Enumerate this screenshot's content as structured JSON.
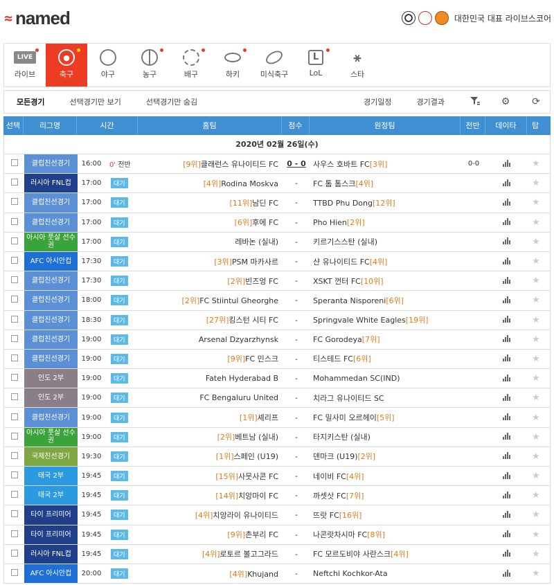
{
  "brand": {
    "logo_text": "named",
    "tagline": "대한민국 대표 라이브스코어"
  },
  "nav": [
    {
      "label": "라이브",
      "icon": "live-icon",
      "badge": "LIVE",
      "dot": true,
      "active": false
    },
    {
      "label": "축구",
      "icon": "soccer-ball-icon",
      "dot": true,
      "active": true
    },
    {
      "label": "야구",
      "icon": "baseball-icon",
      "dot": false,
      "active": false
    },
    {
      "label": "농구",
      "icon": "basketball-icon",
      "dot": true,
      "active": false
    },
    {
      "label": "배구",
      "icon": "volleyball-icon",
      "dot": true,
      "active": false
    },
    {
      "label": "하키",
      "icon": "hockey-puck-icon",
      "dot": true,
      "active": false
    },
    {
      "label": "미식축구",
      "icon": "football-icon",
      "dot": false,
      "active": false
    },
    {
      "label": "LoL",
      "icon": "lol-icon",
      "dot": true,
      "active": false
    },
    {
      "label": "스타",
      "icon": "starcraft-icon",
      "dot": false,
      "active": false
    }
  ],
  "filters": {
    "all": "모든경기",
    "selected_only": "선택경기만 보기",
    "hide_selected": "선택경기만 숨김",
    "schedule": "경기일정",
    "results": "경기결과"
  },
  "table_headers": {
    "select": "선택",
    "league": "리그명",
    "time": "시간",
    "home": "홈팀",
    "score": "점수",
    "away": "원정팀",
    "half": "전반",
    "data": "데이타",
    "top": "탑"
  },
  "date_label": "2020년 02월 26일(수)",
  "colors": {
    "accent": "#ed3c24",
    "header_blue": "#3f8fd2",
    "rank": "#e07b1a"
  },
  "matches": [
    {
      "league": "클럽친선경기",
      "league_color": "#5b8fd6",
      "time": "16:00",
      "status_min": "0'",
      "status_text": "전반",
      "home_rank": "[9위]",
      "home": "클래런스 유나이티드 FC",
      "score": "0 - 0",
      "away": "사우스 호바트 FC",
      "away_rank": "[3위]",
      "half": "0-0"
    },
    {
      "league": "러시아 FNL컵",
      "league_color": "#1f3f8a",
      "time": "17:00",
      "badge": "대기",
      "home_rank": "[4위]",
      "home": "Rodina Moskva",
      "score": "-",
      "away": "FC 톰 톰스크",
      "away_rank": "[4위]",
      "half": ""
    },
    {
      "league": "클럽친선경기",
      "league_color": "#5b8fd6",
      "time": "17:00",
      "badge": "대기",
      "home_rank": "[11위]",
      "home": "남딘 FC",
      "score": "-",
      "away": "TTBD Phu Dong",
      "away_rank": "[12위]",
      "half": ""
    },
    {
      "league": "클럽친선경기",
      "league_color": "#5b8fd6",
      "time": "17:00",
      "badge": "대기",
      "home_rank": "[6위]",
      "home": "후에 FC",
      "score": "-",
      "away": "Pho Hien",
      "away_rank": "[2위]",
      "half": ""
    },
    {
      "league": "아시아 풋살 선수권",
      "league_color": "#3aa33a",
      "time": "17:00",
      "badge": "대기",
      "home_rank": "",
      "home": "레바논 (실내)",
      "score": "-",
      "away": "키르기스스탄 (실내)",
      "away_rank": "",
      "half": ""
    },
    {
      "league": "AFC 아시안컵",
      "league_color": "#1e6fd6",
      "time": "17:30",
      "badge": "대기",
      "home_rank": "[3위]",
      "home": "PSM 마카사르",
      "score": "-",
      "away": "샨 유나이티드 FC",
      "away_rank": "[4위]",
      "half": ""
    },
    {
      "league": "클럽친선경기",
      "league_color": "#5b8fd6",
      "time": "17:30",
      "badge": "대기",
      "home_rank": "[2위]",
      "home": "빈즈엉 FC",
      "score": "-",
      "away": "XSKT 껀터 FC",
      "away_rank": "[10위]",
      "half": ""
    },
    {
      "league": "클럽친선경기",
      "league_color": "#5b8fd6",
      "time": "18:00",
      "badge": "대기",
      "home_rank": "[2위]",
      "home": "FC Stiintul Gheorghe",
      "score": "-",
      "away": "Speranta Nisporeni",
      "away_rank": "[6위]",
      "half": ""
    },
    {
      "league": "클럽친선경기",
      "league_color": "#5b8fd6",
      "time": "18:30",
      "badge": "대기",
      "home_rank": "[27위]",
      "home": "킹스턴 시티 FC",
      "score": "-",
      "away": "Springvale White Eagles",
      "away_rank": "[19위]",
      "half": ""
    },
    {
      "league": "클럽친선경기",
      "league_color": "#5b8fd6",
      "time": "19:00",
      "badge": "대기",
      "home_rank": "",
      "home": "Arsenal Dzyarzhynsk",
      "score": "-",
      "away": "FC Gorodeya",
      "away_rank": "[7위]",
      "half": ""
    },
    {
      "league": "클럽친선경기",
      "league_color": "#5b8fd6",
      "time": "19:00",
      "badge": "대기",
      "home_rank": "[9위]",
      "home": "FC 민스크",
      "score": "-",
      "away": "티스테드 FC",
      "away_rank": "[6위]",
      "half": ""
    },
    {
      "league": "인도 2부",
      "league_color": "#8a7f86",
      "time": "19:00",
      "badge": "대기",
      "home_rank": "",
      "home": "Fateh Hyderabad B",
      "score": "-",
      "away": "Mohammedan SC(IND)",
      "away_rank": "",
      "half": ""
    },
    {
      "league": "인도 2부",
      "league_color": "#8a7f86",
      "time": "19:00",
      "badge": "대기",
      "home_rank": "",
      "home": "FC Bengaluru United",
      "score": "-",
      "away": "치라그 유나이티드 SC",
      "away_rank": "",
      "half": ""
    },
    {
      "league": "클럽친선경기",
      "league_color": "#5b8fd6",
      "time": "19:00",
      "badge": "대기",
      "home_rank": "[1위]",
      "home": "셰리프",
      "score": "-",
      "away": "FC 밀사미 오르헤이",
      "away_rank": "[5위]",
      "half": ""
    },
    {
      "league": "아시아 풋살 선수권",
      "league_color": "#3aa33a",
      "time": "19:00",
      "badge": "대기",
      "home_rank": "[2위]",
      "home": "베트남 (실내)",
      "score": "-",
      "away": "타지키스탄 (실내)",
      "away_rank": "",
      "half": ""
    },
    {
      "league": "국제친선경기",
      "league_color": "#7da743",
      "time": "19:30",
      "badge": "대기",
      "home_rank": "[1위]",
      "home": "스페인 (U19)",
      "score": "-",
      "away": "덴마크 (U19)",
      "away_rank": "[2위]",
      "half": ""
    },
    {
      "league": "태국 2부",
      "league_color": "#2b9ae0",
      "time": "19:45",
      "badge": "대기",
      "home_rank": "[15위]",
      "home": "사뭇사콘 FC",
      "score": "-",
      "away": "네이비 FC",
      "away_rank": "[4위]",
      "half": ""
    },
    {
      "league": "태국 2부",
      "league_color": "#2b9ae0",
      "time": "19:45",
      "badge": "대기",
      "home_rank": "[14위]",
      "home": "치앙마이 FC",
      "score": "-",
      "away": "까셋삿 FC",
      "away_rank": "[7위]",
      "half": ""
    },
    {
      "league": "타이 프리미어",
      "league_color": "#1f3f8a",
      "time": "19:45",
      "badge": "대기",
      "home_rank": "[4위]",
      "home": "치앙라이 유나이티드",
      "score": "-",
      "away": "뜨랏 FC",
      "away_rank": "[16위]",
      "half": ""
    },
    {
      "league": "타이 프리미어",
      "league_color": "#1f3f8a",
      "time": "19:45",
      "badge": "대기",
      "home_rank": "[9위]",
      "home": "촌부리 FC",
      "score": "-",
      "away": "나콘랏차시마 FC",
      "away_rank": "[8위]",
      "half": ""
    },
    {
      "league": "러시아 FNL컵",
      "league_color": "#1f3f8a",
      "time": "19:45",
      "badge": "대기",
      "home_rank": "[4위]",
      "home": "로토르 볼고그라드",
      "score": "-",
      "away": "FC 모르도비야 사란스크",
      "away_rank": "[4위]",
      "half": ""
    },
    {
      "league": "AFC 아시안컵",
      "league_color": "#1e6fd6",
      "time": "20:00",
      "badge": "대기",
      "home_rank": "[4위]",
      "home": "Khujand",
      "score": "-",
      "away": "Neftchi Kochkor-Ata",
      "away_rank": "",
      "half": ""
    }
  ]
}
